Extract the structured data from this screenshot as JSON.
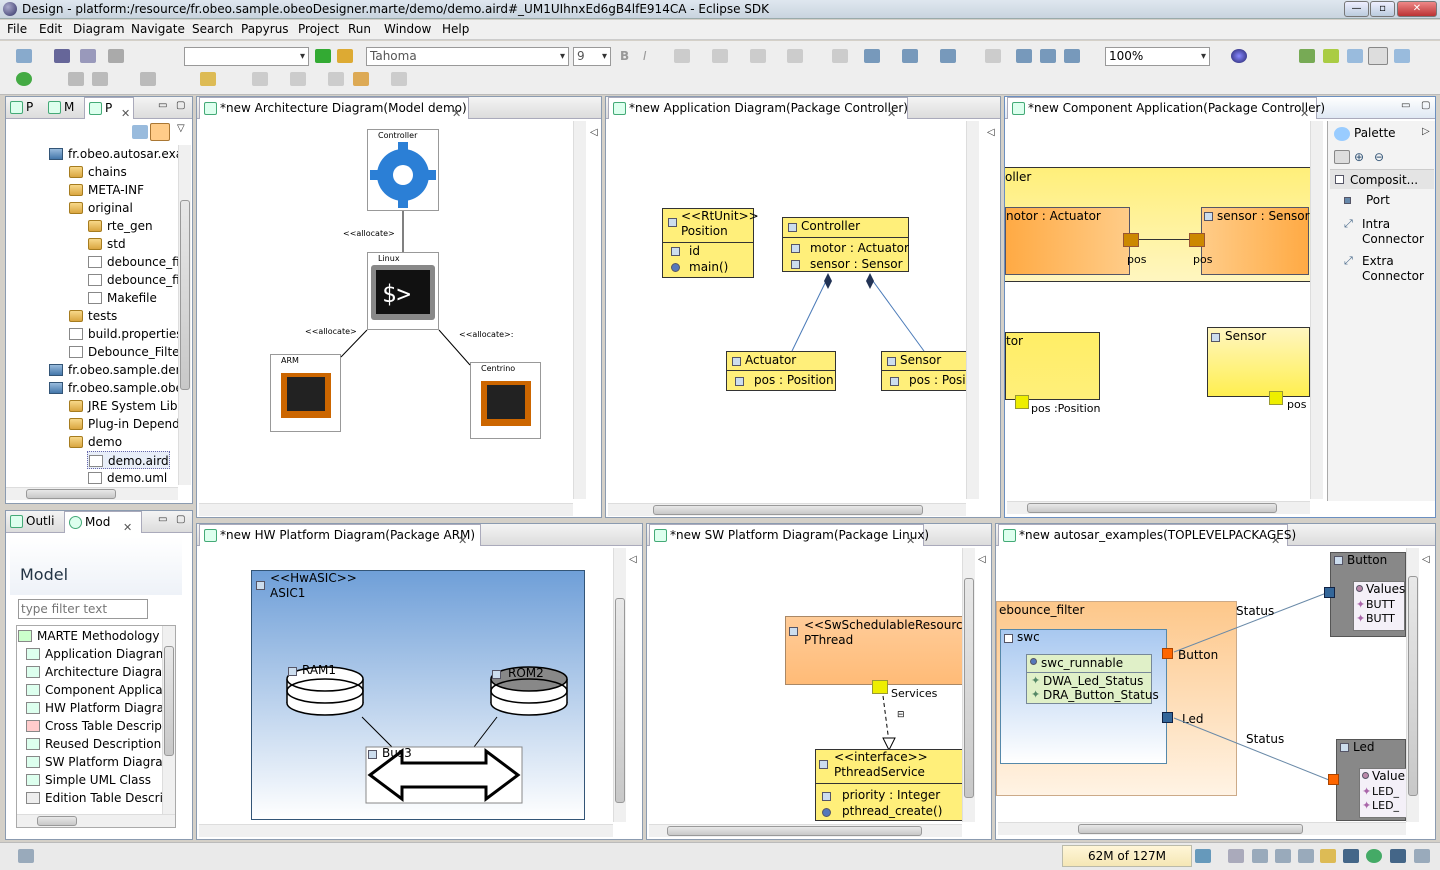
{
  "window": {
    "title": "Design - platform:/resource/fr.obeo.sample.obeoDesigner.marte/demo/demo.aird#_UM1UIhnxEd6gB4lfE914CA - Eclipse SDK",
    "min": "—",
    "max": "▫",
    "close": "✕"
  },
  "menu": [
    "File",
    "Edit",
    "Diagram",
    "Navigate",
    "Search",
    "Papyrus",
    "Project",
    "Run",
    "Window",
    "Help"
  ],
  "toolbar": {
    "font": "Tahoma",
    "size": "9",
    "zoom": "100%"
  },
  "explorer": {
    "tabs": [
      "P",
      "M",
      "P"
    ],
    "items": [
      "fr.obeo.autosar.exar",
      "chains",
      "META-INF",
      "original",
      "rte_gen",
      "std",
      "debounce_fi",
      "debounce_fi",
      "Makefile",
      "tests",
      "build.properties",
      "Debounce_Filter",
      "fr.obeo.sample.dem",
      "fr.obeo.sample.obe",
      "JRE System Libra",
      "Plug-in Depende",
      "demo",
      "demo.aird",
      "demo.uml"
    ]
  },
  "outline": {
    "tabs": [
      "Outli",
      "Mod"
    ],
    "title": "Model",
    "filter_placeholder": "type filter text",
    "items": [
      "MARTE Methodology",
      "Application Diagram",
      "Architecture Diagra",
      "Component Applica",
      "HW Platform Diagra",
      "Cross Table Descript",
      "Reused Description",
      "SW Platform Diagrar",
      "Simple UML Class",
      "Edition Table Descrip"
    ]
  },
  "arch": {
    "tab": "*new Architecture Diagram(Model demo)",
    "controller": "Controller",
    "linux": "Linux",
    "arm": "ARM",
    "centrino": "Centrino",
    "allocate1": "<<allocate>",
    "allocate2": "<<allocate>",
    "allocate3": "<<allocate>:"
  },
  "app": {
    "tab": "*new Application Diagram(Package Controller)",
    "rt_stereo": "<<RtUnit>>",
    "rt_name": "Position",
    "rt_id": "id",
    "rt_main": "main()",
    "ctrl": "Controller",
    "ctrl_motor": "motor : Actuator",
    "ctrl_sensor": "sensor : Sensor",
    "act": "Actuator",
    "act_pos": "pos : Position",
    "sen": "Sensor",
    "sen_pos": "pos : Posi"
  },
  "comp": {
    "tab": "*new Component Application(Package Controller)",
    "ctrl": "oller",
    "motor": "notor : Actuator",
    "sensor": "sensor : Sensor",
    "pos1": "pos",
    "pos2": "pos",
    "tor": "tor",
    "sensor2": "Sensor",
    "pospos": "pos :Position",
    "pos3": "pos",
    "palette": {
      "title": "Palette",
      "group": "Composit...",
      "items": [
        "Port",
        "Intra\nConnector",
        "Extra\nConnector"
      ]
    }
  },
  "hw": {
    "tab": "*new HW Platform Diagram(Package ARM)",
    "stereo": "<<HwASIC>>",
    "name": "ASIC1",
    "ram": "RAM1",
    "rom": "ROM2",
    "bus": "Bus3"
  },
  "sw": {
    "tab": "*new SW Platform Diagram(Package Linux)",
    "res_stereo": "<<SwSchedulableResource",
    "res_name": "PThread",
    "services": "Services",
    "if_stereo": "<<interface>>",
    "if_name": "PthreadService",
    "if_attr": "priority : Integer",
    "if_op": "pthread_create()"
  },
  "autosar": {
    "tab": "*new autosar_examples(TOPLEVELPACKAGES)",
    "filter": "ebounce_filter",
    "swc": "swc",
    "runnable": "swc_runnable",
    "dwa": "DWA_Led_Status",
    "dra": "DRA_Button_Status",
    "button": "Button",
    "led": "Led",
    "status1": "Status",
    "status2": "Status",
    "btnbox": "Button",
    "values": "Values",
    "butt1": "BUTT",
    "butt2": "BUTT",
    "ledbox": "Led",
    "values2": "Value",
    "led1": "LED_",
    "led2": "LED_"
  },
  "status": {
    "heap": "62M of 127M"
  }
}
